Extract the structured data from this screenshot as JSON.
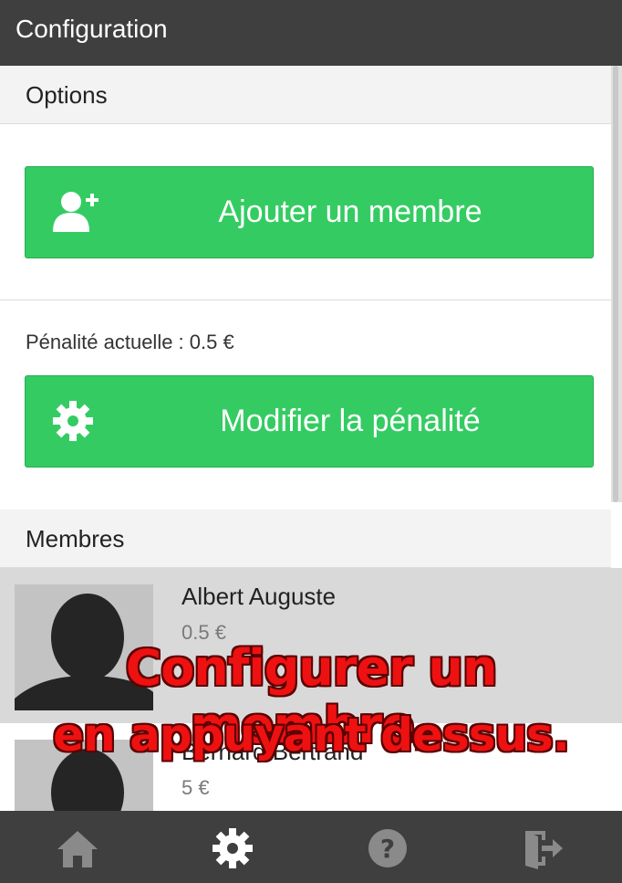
{
  "header": {
    "title": "Configuration"
  },
  "options_section": {
    "title": "Options"
  },
  "add_member_button": {
    "label": "Ajouter un membre",
    "icon": "add-user-icon"
  },
  "penalty": {
    "current_text": "Pénalité actuelle : 0.5 €"
  },
  "modify_penalty_button": {
    "label": "Modifier la pénalité",
    "icon": "gear-icon"
  },
  "members_section": {
    "title": "Membres"
  },
  "members": [
    {
      "name": "Albert Auguste",
      "amount": "0.5 €",
      "selected": true
    },
    {
      "name": "Bernard Bertrand",
      "amount": "5 €",
      "selected": false
    }
  ],
  "overlay": {
    "line1": "Configurer un membre,",
    "line2": "en appuyant dessus."
  },
  "tabbar": {
    "tabs": [
      {
        "icon": "home-icon",
        "active": false
      },
      {
        "icon": "gear-icon",
        "active": true
      },
      {
        "icon": "help-icon",
        "active": false
      },
      {
        "icon": "logout-icon",
        "active": false
      }
    ]
  },
  "colors": {
    "header_bg": "#3f3f3f",
    "green_button": "#34cc62",
    "selected_row": "#d9d9d9",
    "overlay_text": "#ee1111"
  }
}
